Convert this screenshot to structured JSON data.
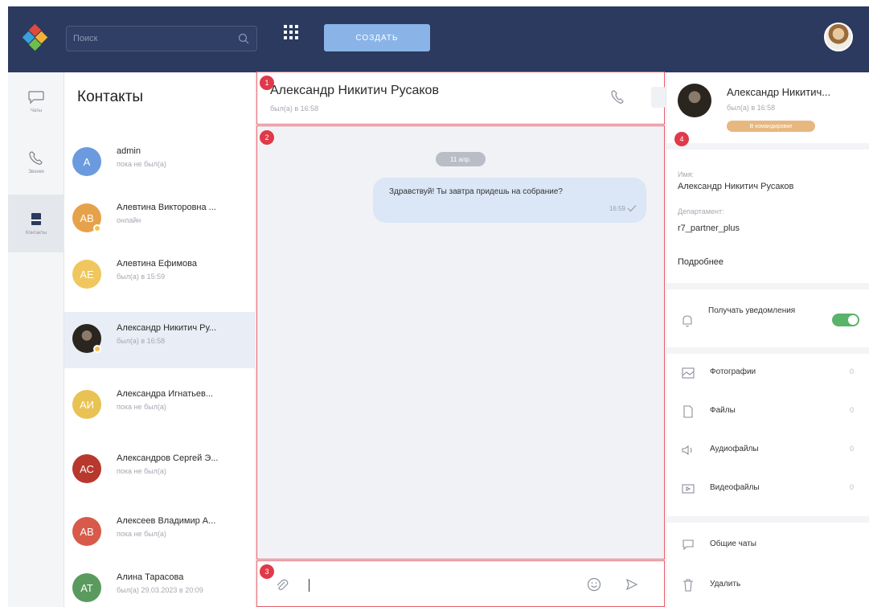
{
  "topbar": {
    "search_placeholder": "Поиск",
    "create_label": "создать",
    "accent": "#2b3a5e"
  },
  "rail": {
    "items": [
      {
        "label": "Чаты",
        "icon": "chat-icon"
      },
      {
        "label": "Звонки",
        "icon": "phone-icon"
      },
      {
        "label": "Контакты",
        "icon": "contacts-icon"
      }
    ],
    "active": "Контакты"
  },
  "contacts": {
    "title": "Контакты",
    "items": [
      {
        "initials": "A",
        "name": "admin",
        "status": "пока не был(а)",
        "color": "#6b9bde"
      },
      {
        "initials": "АВ",
        "name": "Алевтина Викторовна ...",
        "status": "онлайн",
        "color": "#e6a24a"
      },
      {
        "initials": "АЕ",
        "name": "Алевтина Ефимова",
        "status": "был(а) в 15:59",
        "color": "#efc75e"
      },
      {
        "initials": "",
        "name": "Александр Никитич Ру...",
        "status": "был(а) в 16:58",
        "color": "#2b2520"
      },
      {
        "initials": "АИ",
        "name": "Александра Игнатьев...",
        "status": "пока не был(а)",
        "color": "#e8c253"
      },
      {
        "initials": "АС",
        "name": "Александров Сергей Э...",
        "status": "пока не был(а)",
        "color": "#b8382e"
      },
      {
        "initials": "АВ",
        "name": "Алексеев Владимир А...",
        "status": "пока не был(а)",
        "color": "#d75a4a"
      },
      {
        "initials": "АТ",
        "name": "Алина Тарасова",
        "status": "был(а) 29.03.2023 в 20:09",
        "color": "#5a9a5e"
      }
    ]
  },
  "chat": {
    "name": "Александр Никитич Русаков",
    "status": "был(а) в 16:58",
    "date_chip": "11 апр.",
    "message_text": "Здравствуй! Ты завтра придешь на собрание?",
    "message_time": "16:59"
  },
  "badges": {
    "b1": "1",
    "b2": "2",
    "b3": "3",
    "b4": "4"
  },
  "info": {
    "name": "Александр Никитич...",
    "status": "был(а) в 16:58",
    "tag": "В командировке",
    "name_label": "Имя:",
    "name_value": "Александр Никитич Русаков",
    "dept_label": "Департамент:",
    "dept_value": "r7_partner_plus",
    "more": "Подробнее",
    "notifications_label": "Получать уведомления",
    "notifications_on": true,
    "media": [
      {
        "label": "Фотографии",
        "count": "0",
        "icon": "photo-icon"
      },
      {
        "label": "Файлы",
        "count": "0",
        "icon": "file-icon"
      },
      {
        "label": "Аудиофайлы",
        "count": "0",
        "icon": "audio-icon"
      },
      {
        "label": "Видеофайлы",
        "count": "0",
        "icon": "video-icon"
      }
    ],
    "common_chats": "Общие чаты",
    "delete": "Удалить"
  }
}
